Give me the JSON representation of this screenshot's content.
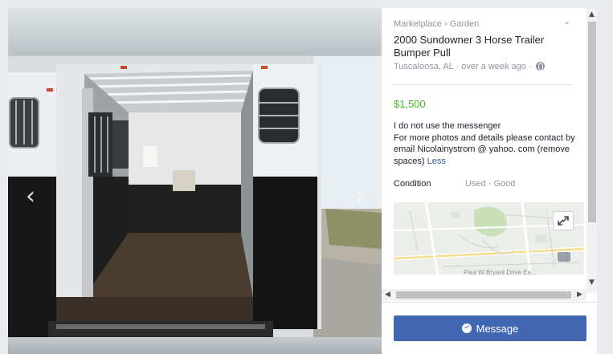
{
  "listing": {
    "breadcrumb": [
      "Marketplace",
      "Garden"
    ],
    "breadcrumb_separator": "›",
    "title": "2000 Sundowner 3 Horse Trailer Bumper Pull",
    "location": "Tuscaloosa, AL",
    "posted": "over a week ago",
    "meta_separator": "·",
    "price": "$1,500",
    "description": "I do not use the messenger\nFor more photos and details please contact by email Nicolainystrom @ yahoo. com (remove spaces) ",
    "less_link": "Less",
    "condition_label": "Condition",
    "condition_value": "Used - Good",
    "map_street_label": "Paul W Bryant Drive Ea..."
  },
  "actions": {
    "message_label": "Message"
  },
  "icons": {
    "prev": "chevron-left-icon",
    "next": "chevron-right-icon",
    "menu": "chevron-down-icon",
    "privacy": "globe-icon",
    "expand": "expand-icon",
    "messenger": "messenger-icon"
  },
  "glyphs": {
    "prev": "‹",
    "next": "›",
    "menu": "⌄",
    "scroll_up": "▲",
    "scroll_down": "▼",
    "scroll_left": "◀",
    "scroll_right": "▶"
  },
  "colors": {
    "price": "#42b72a",
    "link": "#365899",
    "button": "#4267b2",
    "muted": "#90949c"
  }
}
